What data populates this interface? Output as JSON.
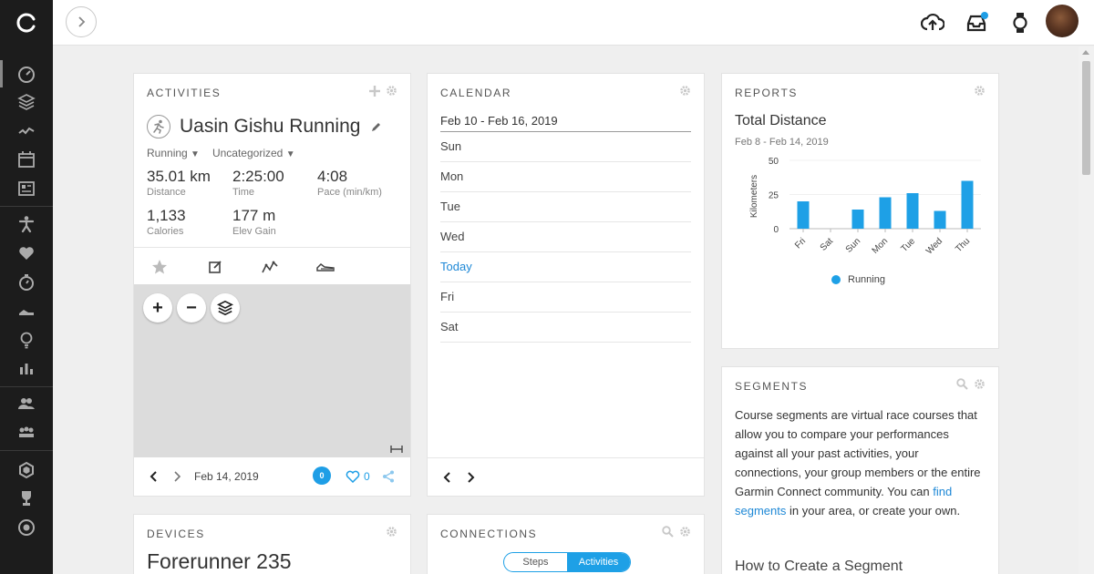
{
  "activities": {
    "title": "ACTIVITIES",
    "name": "Uasin Gishu Running",
    "type": "Running",
    "category": "Uncategorized",
    "stats": [
      {
        "value": "35.01 km",
        "label": "Distance"
      },
      {
        "value": "2:25:00",
        "label": "Time"
      },
      {
        "value": "4:08",
        "label": "Pace (min/km)"
      },
      {
        "value": "1,133",
        "label": "Calories"
      },
      {
        "value": "177 m",
        "label": "Elev Gain"
      }
    ],
    "date": "Feb 14, 2019",
    "comments": "0",
    "likes": "0"
  },
  "calendar": {
    "title": "CALENDAR",
    "range": "Feb 10 - Feb 16, 2019",
    "days": [
      "Sun",
      "Mon",
      "Tue",
      "Wed",
      "Today",
      "Fri",
      "Sat"
    ]
  },
  "reports": {
    "title": "REPORTS",
    "chart_title": "Total Distance",
    "range": "Feb 8 - Feb 14, 2019"
  },
  "chart_data": {
    "type": "bar",
    "title": "Total Distance",
    "ylabel": "Kilometers",
    "categories": [
      "Fri",
      "Sat",
      "Sun",
      "Mon",
      "Tue",
      "Wed",
      "Thu"
    ],
    "series": [
      {
        "name": "Running",
        "values": [
          20,
          0,
          14,
          23,
          26,
          13,
          35
        ]
      }
    ],
    "ylim": [
      0,
      50
    ],
    "yticks": [
      "0",
      "25",
      "50"
    ],
    "color": "#1ea0e6",
    "legend": "bottom"
  },
  "segments": {
    "title": "SEGMENTS",
    "text1": "Course segments are virtual race courses that allow you to compare your performances against all your past activities, your connections, your group members or the entire Garmin Connect community. You can ",
    "link": "find segments",
    "text2": " in your area, or create your own.",
    "heading": "How to Create a Segment"
  },
  "devices": {
    "title": "DEVICES",
    "name": "Forerunner 235"
  },
  "connections": {
    "title": "CONNECTIONS",
    "toggle": [
      "Steps",
      "Activities"
    ]
  }
}
